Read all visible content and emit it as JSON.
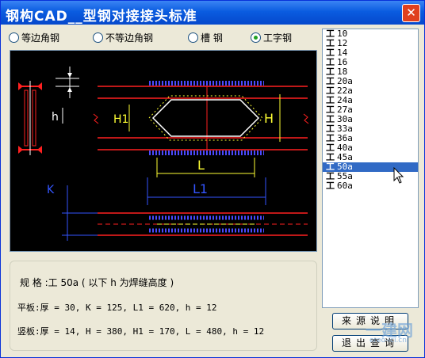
{
  "window": {
    "title": "钢构CAD__型钢对接接头标准",
    "close_glyph": "✕"
  },
  "section_types": {
    "options": [
      "等边角钢",
      "不等边角钢",
      "槽 钢",
      "工字钢"
    ],
    "selected": "工字钢"
  },
  "drawing": {
    "labels": {
      "h": "h",
      "H1": "H1",
      "H": "H",
      "L": "L",
      "L1": "L1",
      "K": "K"
    }
  },
  "info": {
    "spec": "规 格 :工 50a  ( 以下 h 为焊缝高度 )",
    "flange_plate": "平板:厚 = 30, K = 125, L1 = 620, h = 12",
    "web_plate": "竖板:厚 = 14, H = 380, H1 = 170, L = 480, h = 12"
  },
  "size_list": {
    "items": [
      "10",
      "12",
      "14",
      "16",
      "18",
      "20a",
      "22a",
      "24a",
      "27a",
      "30a",
      "33a",
      "36a",
      "40a",
      "45a",
      "50a",
      "55a",
      "60a"
    ],
    "selected": "50a",
    "item_icon": "工"
  },
  "buttons": {
    "source_note": "来源说明",
    "exit_query": "退出查询"
  },
  "watermark": {
    "text": "一建网",
    "url": "ereo-ici.cn"
  },
  "colors": {
    "titlebar": "#0a5ce0",
    "canvas_bg": "#000000",
    "selection": "#316ac5",
    "weld": "#4a4aff",
    "plate_red": "#ff2020",
    "dim_yellow": "#ffff33",
    "dim_blue": "#3355ff"
  }
}
